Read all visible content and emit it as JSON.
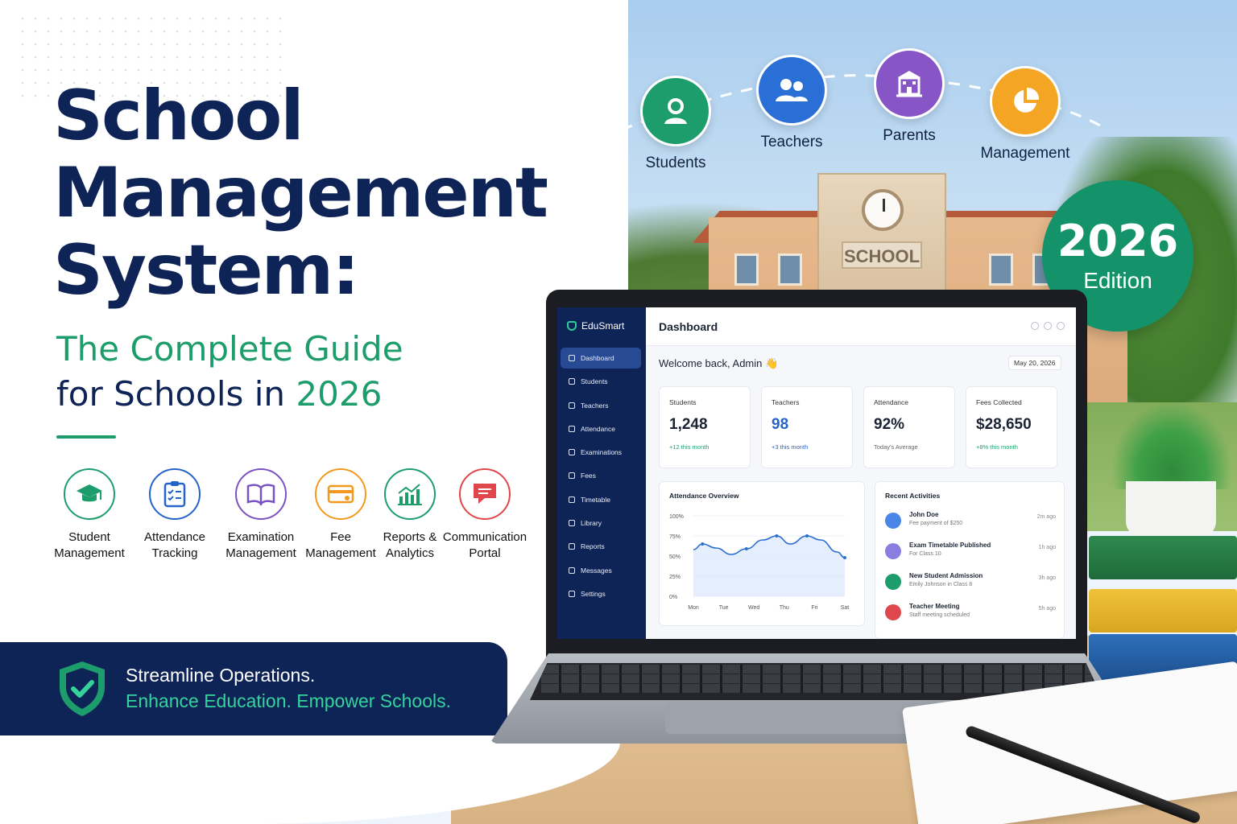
{
  "headline": {
    "line1": "School",
    "line2": "Management",
    "line3": "System:",
    "sub_part1": "The Complete Guide",
    "sub_part2": "for Schools in ",
    "sub_year": "2026"
  },
  "features": [
    {
      "label1": "Student",
      "label2": "Management",
      "color": "#1e9d6c",
      "icon": "graduation-cap-icon"
    },
    {
      "label1": "Attendance",
      "label2": "Tracking",
      "color": "#2563c9",
      "icon": "clipboard-checklist-icon"
    },
    {
      "label1": "Examination",
      "label2": "Management",
      "color": "#7b52c2",
      "icon": "open-book-icon"
    },
    {
      "label1": "Fee",
      "label2": "Management",
      "color": "#f29a1f",
      "icon": "credit-card-icon"
    },
    {
      "label1": "Reports &",
      "label2": "Analytics",
      "color": "#1e9d6c",
      "icon": "bar-chart-icon"
    },
    {
      "label1": "Communication",
      "label2": "Portal",
      "color": "#e0474c",
      "icon": "chat-bubble-icon"
    }
  ],
  "banner": {
    "line1": "Streamline Operations.",
    "line2": "Enhance Education. Empower Schools."
  },
  "roles": [
    {
      "label": "Students",
      "color": "#1e9d6c",
      "icon": "student-icon"
    },
    {
      "label": "Teachers",
      "color": "#2a6fd6",
      "icon": "teachers-icon"
    },
    {
      "label": "Parents",
      "color": "#8755c6",
      "icon": "school-building-icon"
    },
    {
      "label": "Management",
      "color": "#f5a524",
      "icon": "pie-chart-icon"
    }
  ],
  "badge": {
    "year": "2026",
    "text": "Edition"
  },
  "scene": {
    "sign": "SCHOOL"
  },
  "dashboard": {
    "brand": "EduSmart",
    "nav": [
      {
        "label": "Dashboard",
        "active": true
      },
      {
        "label": "Students"
      },
      {
        "label": "Teachers"
      },
      {
        "label": "Attendance"
      },
      {
        "label": "Examinations"
      },
      {
        "label": "Fees"
      },
      {
        "label": "Timetable"
      },
      {
        "label": "Library"
      },
      {
        "label": "Reports"
      },
      {
        "label": "Messages"
      },
      {
        "label": "Settings"
      }
    ],
    "title": "Dashboard",
    "welcome": "Welcome back, Admin 👋",
    "date": "May 20, 2026",
    "stats": [
      {
        "title": "Students",
        "value": "1,248",
        "sub": "+12 this month",
        "value_color": "#1c2433",
        "sub_color": "#1e9d6c"
      },
      {
        "title": "Teachers",
        "value": "98",
        "sub": "+3 this month",
        "value_color": "#2563c9",
        "sub_color": "#2563c9"
      },
      {
        "title": "Attendance",
        "value": "92%",
        "sub": "Today's Average",
        "value_color": "#1c2433",
        "sub_color": "#666666"
      },
      {
        "title": "Fees Collected",
        "value": "$28,650",
        "sub": "+8% this month",
        "value_color": "#1c2433",
        "sub_color": "#1e9d6c"
      }
    ],
    "attendance_title": "Attendance Overview",
    "recent_title": "Recent Activities",
    "activities": [
      {
        "name": "John Doe",
        "desc": "Fee payment of $250",
        "time": "2m ago",
        "color": "#4a86e8"
      },
      {
        "name": "Exam Timetable Published",
        "desc": "For Class 10",
        "time": "1h ago",
        "color": "#8a7fe0"
      },
      {
        "name": "New Student Admission",
        "desc": "Emily Johnson in Class 8",
        "time": "3h ago",
        "color": "#1e9d6c"
      },
      {
        "name": "Teacher Meeting",
        "desc": "Staff meeting scheduled",
        "time": "5h ago",
        "color": "#e0474c"
      }
    ]
  },
  "chart_data": {
    "type": "line",
    "title": "Attendance Overview",
    "categories": [
      "Mon",
      "Tue",
      "Wed",
      "Thu",
      "Fri",
      "Sat"
    ],
    "x": [
      0,
      0.3,
      0.75,
      1.25,
      1.75,
      2.3,
      2.75,
      3.2,
      3.75,
      4.2,
      4.75,
      5
    ],
    "values": [
      58,
      65,
      60,
      52,
      59,
      70,
      75,
      65,
      75,
      70,
      55,
      48
    ],
    "yticks": [
      "0%",
      "25%",
      "50%",
      "75%",
      "100%"
    ],
    "ylim": [
      0,
      100
    ],
    "line_color": "#2d6fd0"
  }
}
